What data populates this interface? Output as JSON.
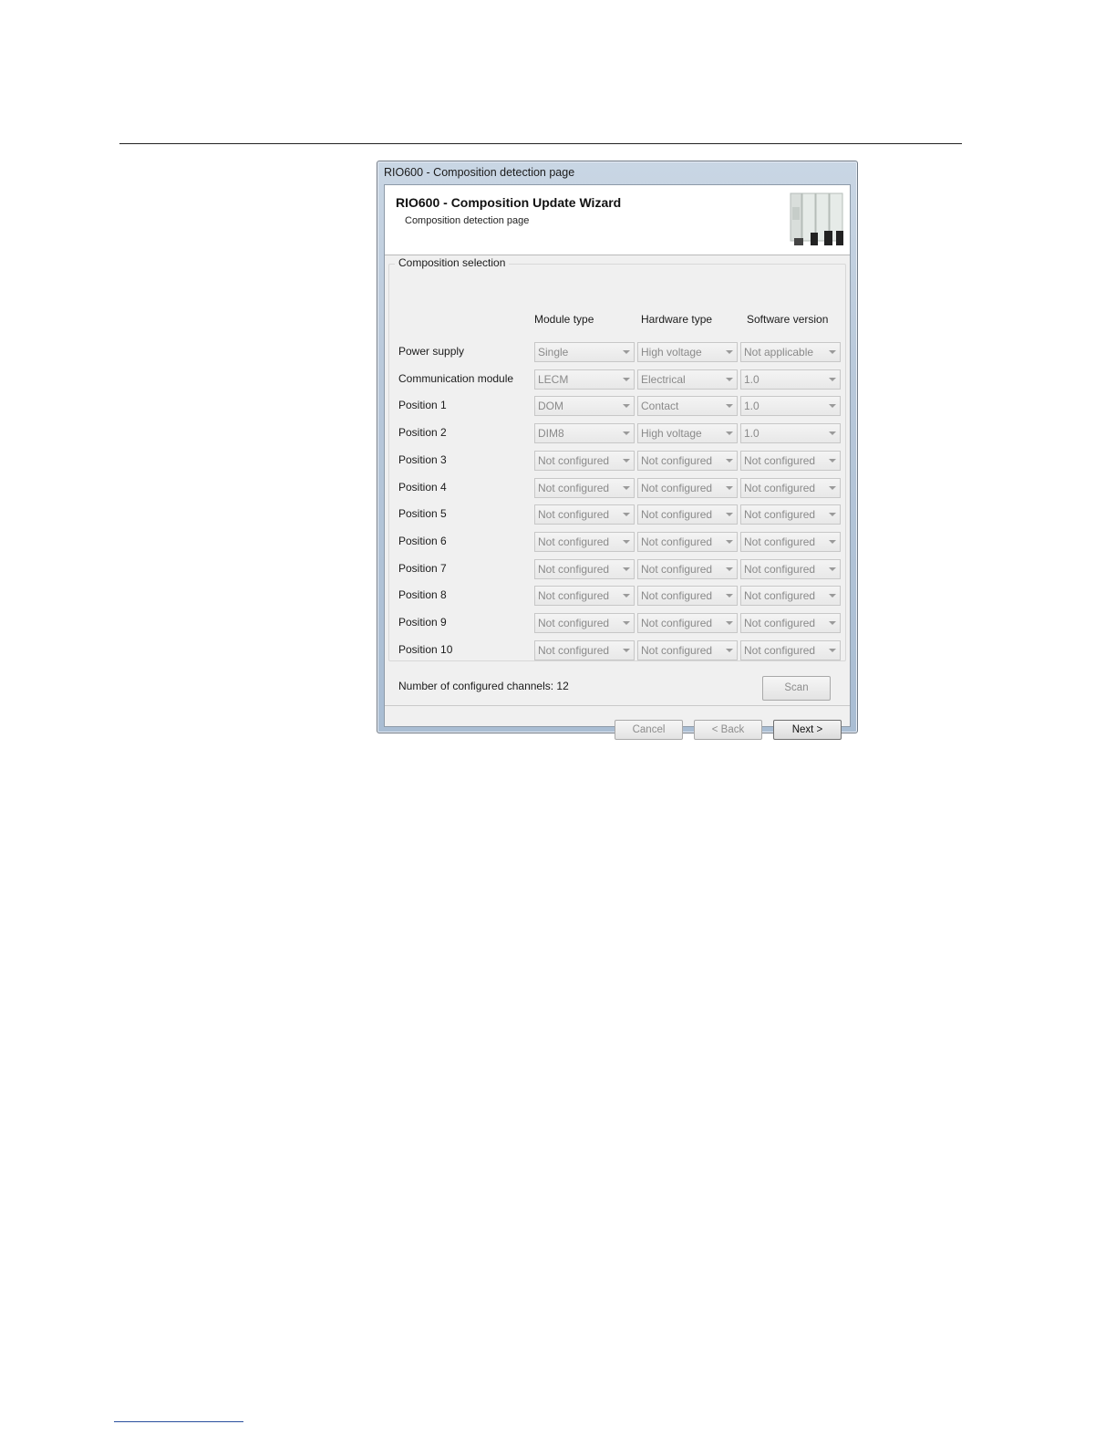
{
  "window": {
    "title": "RIO600 - Composition detection page"
  },
  "header": {
    "title": "RIO600 - Composition Update Wizard",
    "subtitle": "Composition detection page"
  },
  "group": {
    "title": "Composition selection"
  },
  "columns": {
    "module": "Module type",
    "hardware": "Hardware type",
    "software": "Software version"
  },
  "rows": [
    {
      "label": "Power supply",
      "module": "Single",
      "hardware": "High voltage",
      "software": "Not applicable"
    },
    {
      "label": "Communication module",
      "module": "LECM",
      "hardware": "Electrical",
      "software": "1.0"
    },
    {
      "label": "Position 1",
      "module": "DOM",
      "hardware": "Contact",
      "software": "1.0"
    },
    {
      "label": "Position 2",
      "module": "DIM8",
      "hardware": "High voltage",
      "software": "1.0"
    },
    {
      "label": "Position 3",
      "module": "Not configured",
      "hardware": "Not configured",
      "software": "Not configured"
    },
    {
      "label": "Position 4",
      "module": "Not configured",
      "hardware": "Not configured",
      "software": "Not configured"
    },
    {
      "label": "Position 5",
      "module": "Not configured",
      "hardware": "Not configured",
      "software": "Not configured"
    },
    {
      "label": "Position 6",
      "module": "Not configured",
      "hardware": "Not configured",
      "software": "Not configured"
    },
    {
      "label": "Position 7",
      "module": "Not configured",
      "hardware": "Not configured",
      "software": "Not configured"
    },
    {
      "label": "Position 8",
      "module": "Not configured",
      "hardware": "Not configured",
      "software": "Not configured"
    },
    {
      "label": "Position 9",
      "module": "Not configured",
      "hardware": "Not configured",
      "software": "Not configured"
    },
    {
      "label": "Position 10",
      "module": "Not configured",
      "hardware": "Not configured",
      "software": "Not configured"
    }
  ],
  "status": {
    "channels_text": "Number of configured channels: 12"
  },
  "buttons": {
    "scan": "Scan",
    "cancel": "Cancel",
    "back": "< Back",
    "next": "Next >"
  }
}
